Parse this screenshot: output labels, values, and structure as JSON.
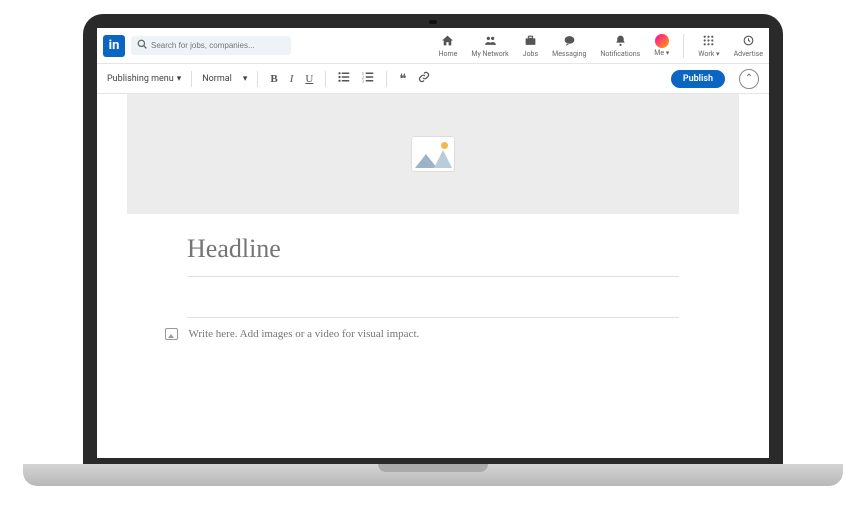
{
  "logo": "in",
  "search": {
    "placeholder": "Search for jobs, companies..."
  },
  "nav": {
    "home": "Home",
    "network": "My Network",
    "jobs": "Jobs",
    "messaging": "Messaging",
    "notifications": "Notifications",
    "me": "Me ▾",
    "work": "Work ▾",
    "advertise": "Advertise"
  },
  "toolbar": {
    "publishing_menu": "Publishing menu",
    "style": "Normal",
    "publish": "Publish"
  },
  "editor": {
    "headline_placeholder": "Headline",
    "body_placeholder": "Write here. Add images or a video for visual impact."
  }
}
